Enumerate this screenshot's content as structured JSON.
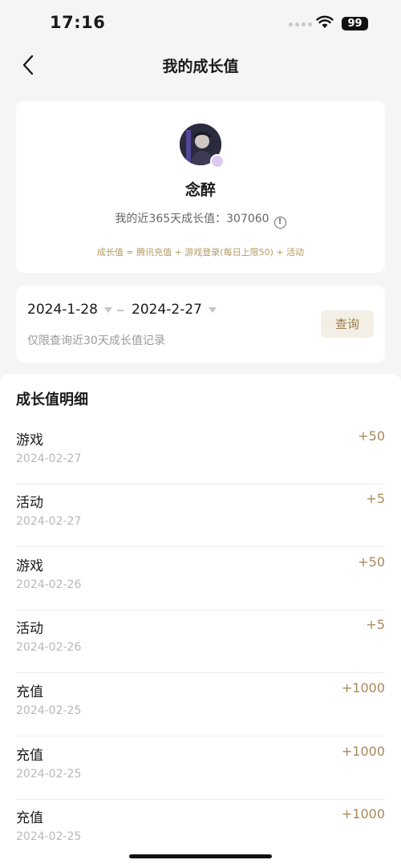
{
  "status_bar": {
    "time": "17:16",
    "battery": "99"
  },
  "nav": {
    "title": "我的成长值"
  },
  "profile": {
    "name": "念醉",
    "growth_label": "我的近365天成长值：307060",
    "info_glyph": "!",
    "formula": "成长值 = 腾讯充值 + 游戏登录(每日上限50) + 活动"
  },
  "date_filter": {
    "start": "2024-1-28",
    "end": "2024-2-27",
    "hint": "仅限查询近30天成长值记录",
    "query_label": "查询"
  },
  "details": {
    "title": "成长值明细",
    "rows": [
      {
        "label": "游戏",
        "date": "2024-02-27",
        "value": "+50"
      },
      {
        "label": "活动",
        "date": "2024-02-27",
        "value": "+5"
      },
      {
        "label": "游戏",
        "date": "2024-02-26",
        "value": "+50"
      },
      {
        "label": "活动",
        "date": "2024-02-26",
        "value": "+5"
      },
      {
        "label": "充值",
        "date": "2024-02-25",
        "value": "+1000"
      },
      {
        "label": "充值",
        "date": "2024-02-25",
        "value": "+1000"
      },
      {
        "label": "充值",
        "date": "2024-02-25",
        "value": "+1000"
      }
    ]
  },
  "colors": {
    "accent": "#a88a5a",
    "formula": "#b49a62",
    "button_bg": "#f4efe6"
  }
}
